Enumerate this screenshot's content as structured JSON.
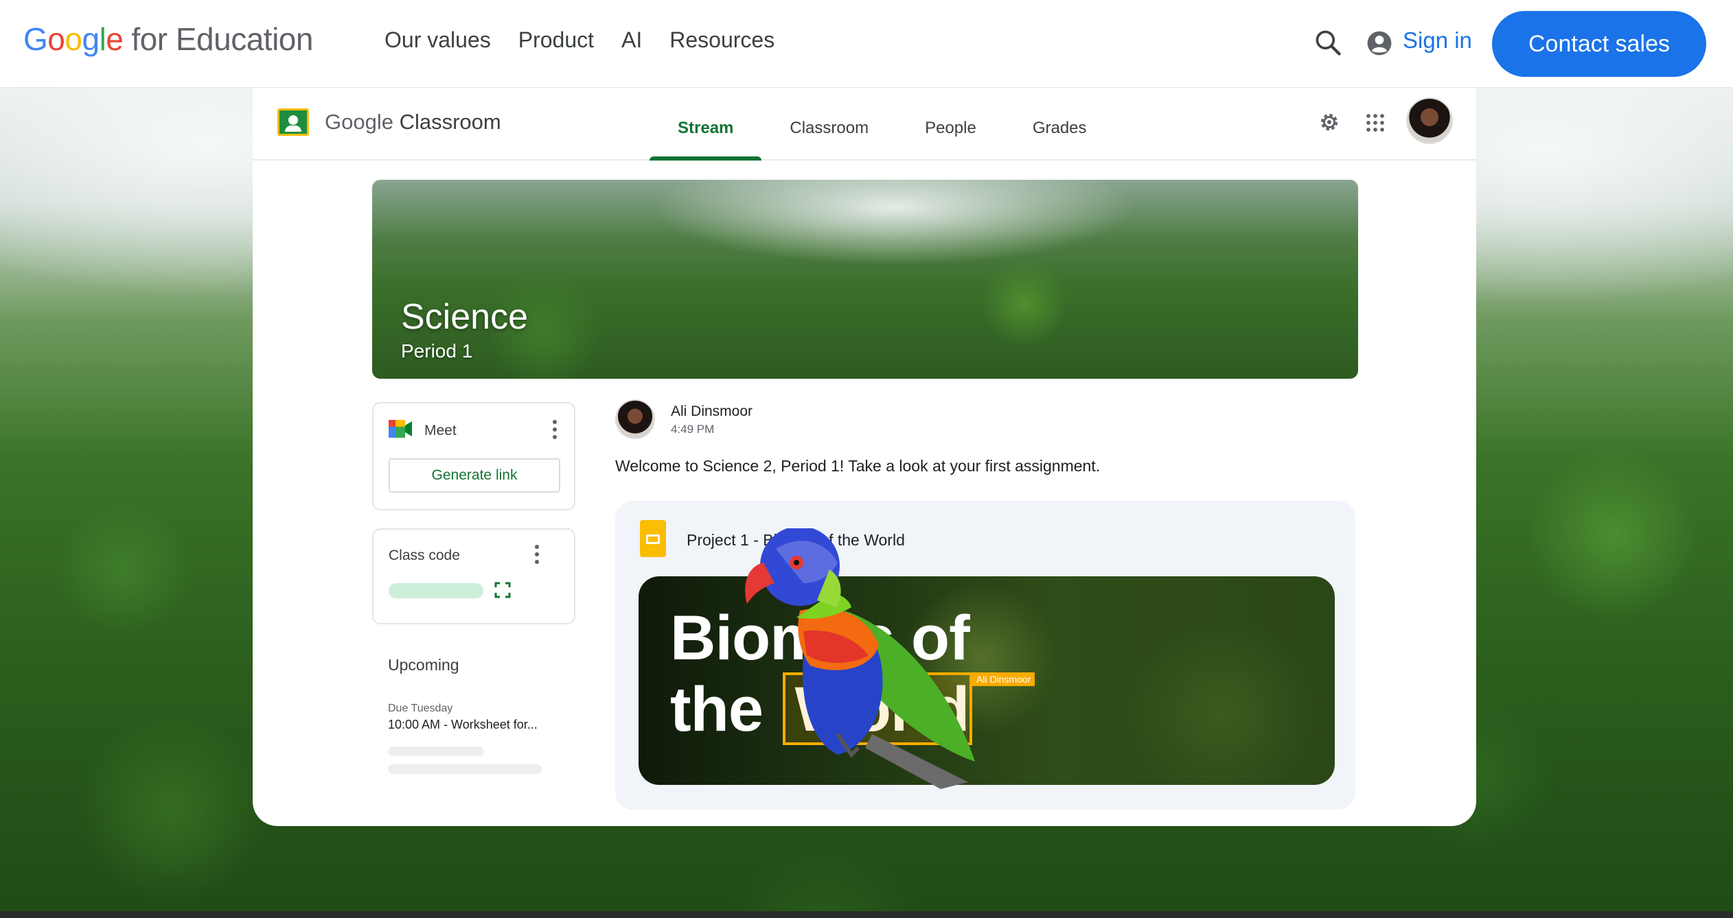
{
  "header": {
    "logo": {
      "g1": "G",
      "o1": "o",
      "o2": "o",
      "g2": "g",
      "l": "l",
      "e": "e",
      "suffix": "for Education"
    },
    "nav": [
      "Our values",
      "Product",
      "AI",
      "Resources"
    ],
    "sign_in": "Sign in",
    "contact": "Contact sales"
  },
  "classroom": {
    "app_title_prefix": "Google",
    "app_title_name": "Classroom",
    "tabs": [
      "Stream",
      "Classroom",
      "People",
      "Grades"
    ],
    "active_tab": "Stream",
    "banner": {
      "title": "Science",
      "subtitle": "Period 1"
    },
    "meet": {
      "label": "Meet",
      "button": "Generate link"
    },
    "class_code": {
      "label": "Class code"
    },
    "upcoming": {
      "title": "Upcoming",
      "due": "Due Tuesday",
      "item": "10:00 AM - Worksheet for..."
    },
    "post": {
      "author": "Ali Dinsmoor",
      "time": "4:49 PM",
      "text": "Welcome to Science 2, Period 1! Take a look at your first assignment."
    },
    "attachment": {
      "title": "Project 1 - Biomes of the World",
      "thumb_line1": "Biomes of",
      "thumb_line2_a": "the",
      "thumb_line2_b": "World",
      "tag": "Ali Dinsmoor"
    }
  },
  "colors": {
    "brand_blue": "#1a73e8",
    "classroom_green": "#137333",
    "highlight": "#f9ab00"
  },
  "icons": [
    "search-icon",
    "account-icon",
    "gear-icon",
    "apps-grid-icon",
    "meet-icon",
    "kebab-icon",
    "expand-icon",
    "slides-icon"
  ]
}
